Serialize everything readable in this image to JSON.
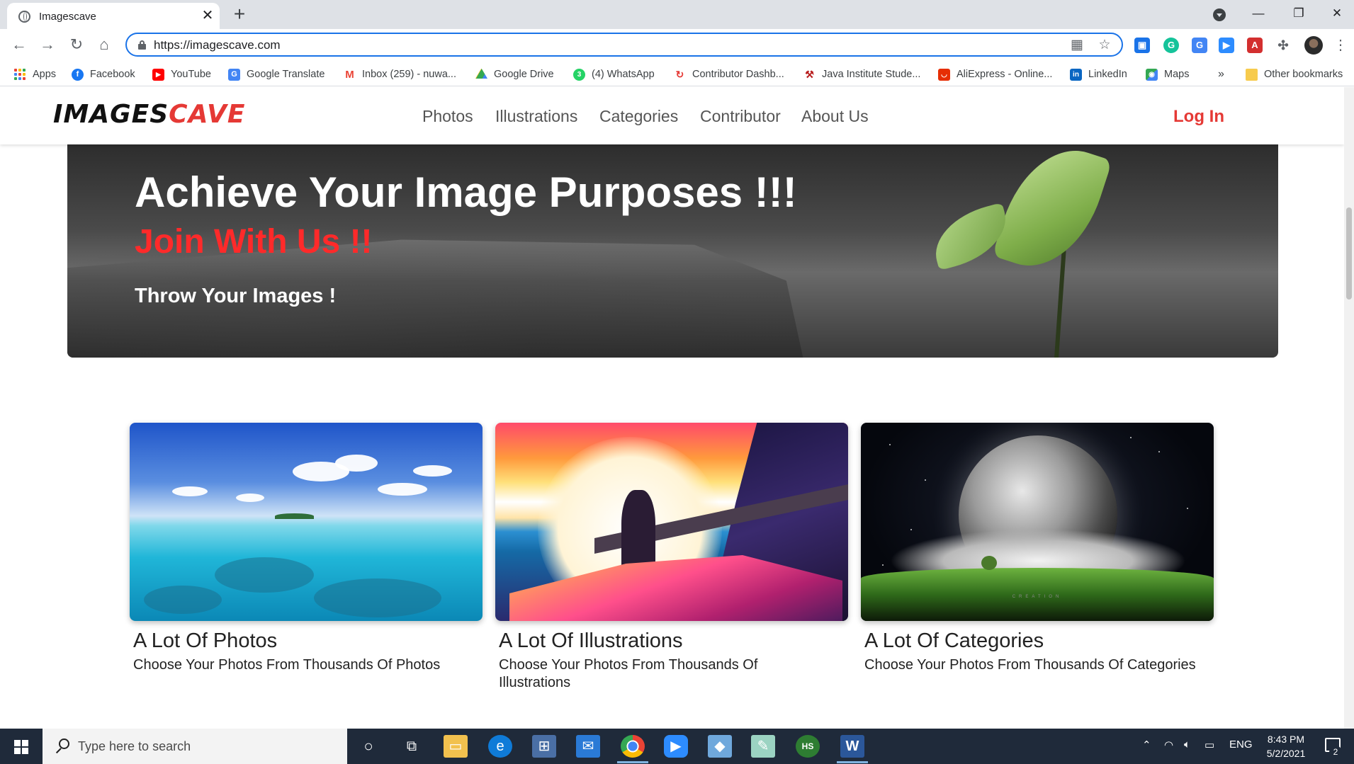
{
  "browser": {
    "tab_title": "Imagescave",
    "url": "https://imagescave.com",
    "bookmarks": [
      {
        "label": "Apps",
        "icon": "apps-grid-icon",
        "color": "#4285f4"
      },
      {
        "label": "Facebook",
        "icon": "facebook-icon",
        "color": "#1877f2"
      },
      {
        "label": "YouTube",
        "icon": "youtube-icon",
        "color": "#ff0000"
      },
      {
        "label": "Google Translate",
        "icon": "google-translate-icon",
        "color": "#4285f4"
      },
      {
        "label": "Inbox (259) - nuwa...",
        "icon": "gmail-icon",
        "color": "#ea4335"
      },
      {
        "label": "Google Drive",
        "icon": "google-drive-icon",
        "color": "#0f9d58"
      },
      {
        "label": "(4) WhatsApp",
        "icon": "whatsapp-icon",
        "color": "#25d366"
      },
      {
        "label": "Contributor Dashb...",
        "icon": "contributor-icon",
        "color": "#e53935"
      },
      {
        "label": "Java Institute Stude...",
        "icon": "java-institute-icon",
        "color": "#b71c1c"
      },
      {
        "label": "AliExpress - Online...",
        "icon": "aliexpress-icon",
        "color": "#e62e04"
      },
      {
        "label": "LinkedIn",
        "icon": "linkedin-icon",
        "color": "#0a66c2"
      },
      {
        "label": "Maps",
        "icon": "maps-icon",
        "color": "#34a853"
      }
    ],
    "bookmarks_overflow": "»",
    "other_bookmarks": "Other bookmarks"
  },
  "site": {
    "logo_part1": "IMAGES",
    "logo_part2": "CAVE",
    "nav": [
      "Photos",
      "Illustrations",
      "Categories",
      "Contributor",
      "About Us"
    ],
    "login": "Log In",
    "hero": {
      "title": "Achieve Your Image Purposes !!!",
      "subtitle": "Join With Us !!",
      "tagline": "Throw Your Images !"
    },
    "cards": [
      {
        "title": "A Lot Of Photos",
        "desc": "Choose Your Photos From Thousands Of Photos"
      },
      {
        "title": "A Lot Of Illustrations",
        "desc": "Choose Your Photos From Thousands Of Illustrations"
      },
      {
        "title": "A Lot Of Categories",
        "desc": "Choose Your Photos From Thousands Of Categories"
      }
    ],
    "planet_caption": "CREATION"
  },
  "colors": {
    "brand_red": "#e53935",
    "hero_red": "#ff2a2a",
    "nav_text": "#555555"
  },
  "taskbar": {
    "search_placeholder": "Type here to search",
    "language": "ENG",
    "time": "8:43 PM",
    "date": "5/2/2021",
    "notification_count": "2"
  }
}
